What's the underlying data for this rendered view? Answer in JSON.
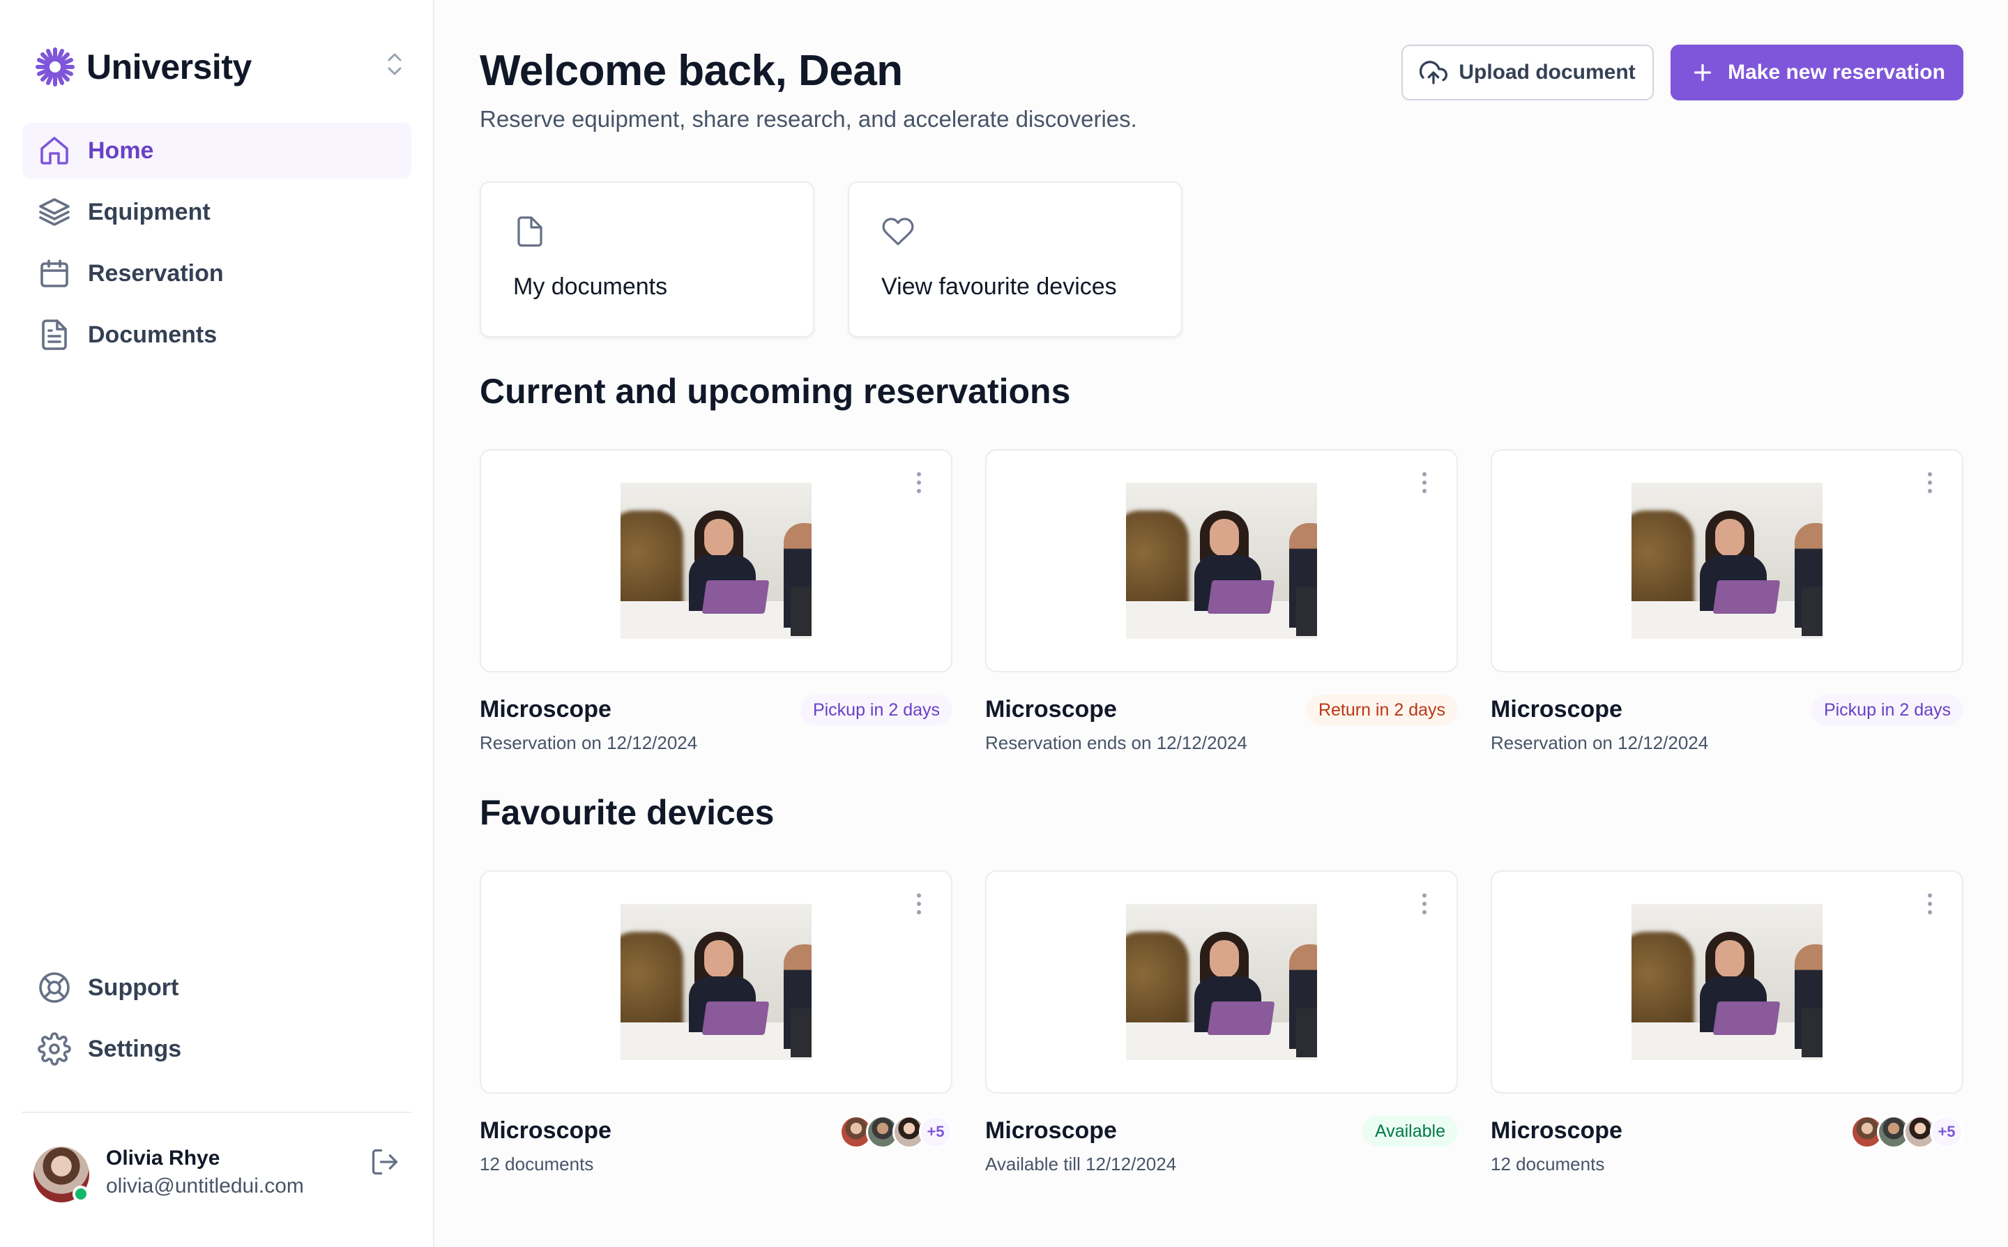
{
  "brand": {
    "name": "University"
  },
  "nav": {
    "items": [
      {
        "label": "Home",
        "icon": "home-icon",
        "active": true
      },
      {
        "label": "Equipment",
        "icon": "layers-icon"
      },
      {
        "label": "Reservation",
        "icon": "calendar-icon"
      },
      {
        "label": "Documents",
        "icon": "file-text-icon"
      }
    ],
    "bottom": [
      {
        "label": "Support",
        "icon": "life-buoy-icon"
      },
      {
        "label": "Settings",
        "icon": "gear-icon"
      }
    ]
  },
  "user": {
    "name": "Olivia Rhye",
    "email": "olivia@untitledui.com"
  },
  "header": {
    "title": "Welcome back, Dean",
    "subtitle": "Reserve equipment, share research, and accelerate discoveries.",
    "upload_label": "Upload document",
    "primary_label": "Make new reservation"
  },
  "quick_actions": [
    {
      "label": "My documents",
      "icon": "file-icon"
    },
    {
      "label": "View favourite devices",
      "icon": "heart-icon"
    }
  ],
  "reservations": {
    "title": "Current and upcoming reservations",
    "items": [
      {
        "name": "Microscope",
        "subtitle": "Reservation on 12/12/2024",
        "badge": "Pickup in 2 days",
        "badge_tone": "purple"
      },
      {
        "name": "Microscope",
        "subtitle": "Reservation ends on 12/12/2024",
        "badge": "Return in 2 days",
        "badge_tone": "orange"
      },
      {
        "name": "Microscope",
        "subtitle": "Reservation on 12/12/2024",
        "badge": "Pickup in 2 days",
        "badge_tone": "purple"
      }
    ]
  },
  "favourites": {
    "title": "Favourite devices",
    "items": [
      {
        "name": "Microscope",
        "subtitle": "12 documents",
        "more": "+5"
      },
      {
        "name": "Microscope",
        "subtitle": "Available till 12/12/2024",
        "badge": "Available"
      },
      {
        "name": "Microscope",
        "subtitle": "12 documents",
        "more": "+5"
      }
    ]
  },
  "colors": {
    "accent": "#7f56d9",
    "accent_text": "#6941c6",
    "active_bg": "#f9f5ff",
    "orange_text": "#b93815",
    "green_text": "#027a48",
    "online": "#12b76a"
  }
}
